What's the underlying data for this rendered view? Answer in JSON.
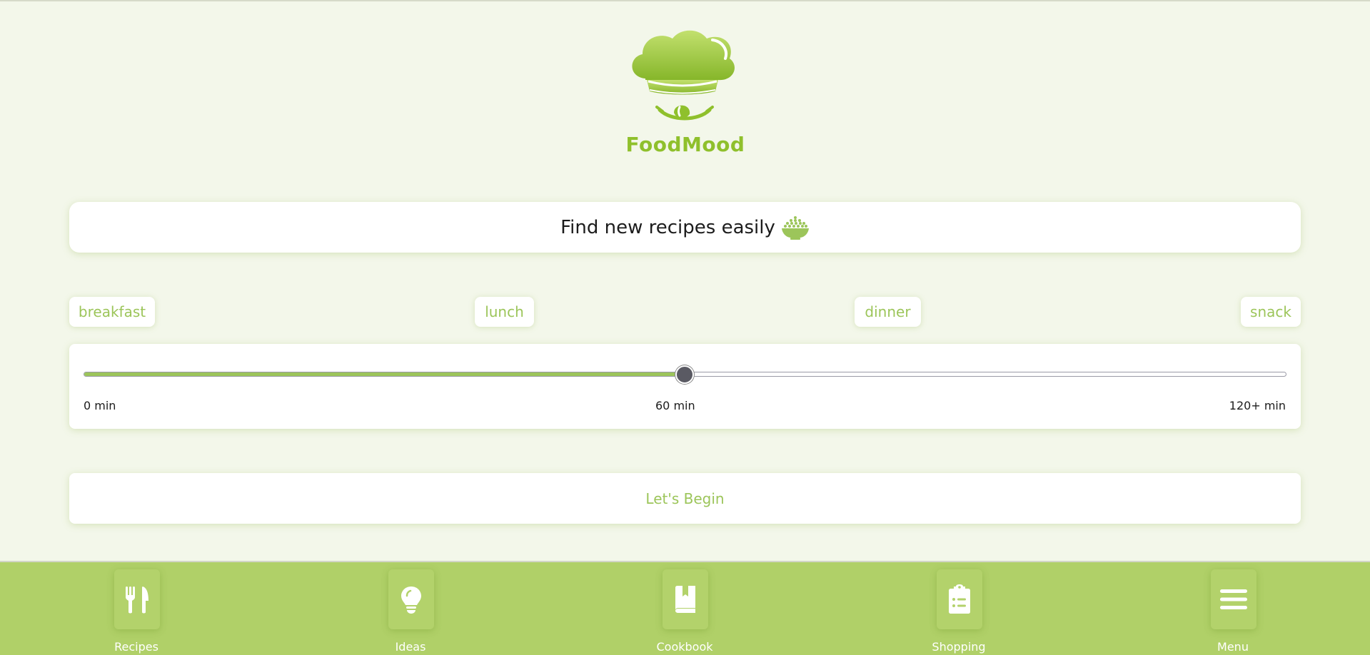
{
  "app": {
    "name": "FoodMood",
    "accent_color": "#9cc55a",
    "brand_color": "#8fc02c",
    "nav_color": "#b0d068",
    "background_color": "#f3f7ea"
  },
  "logo": {
    "icon": "chef-hat-smile-icon"
  },
  "headline": {
    "text": "Find new recipes easily",
    "icon": "bowl-icon"
  },
  "meal_filters": [
    {
      "label": "breakfast"
    },
    {
      "label": "lunch"
    },
    {
      "label": "dinner"
    },
    {
      "label": "snack"
    }
  ],
  "time_slider": {
    "min": 0,
    "max": 120,
    "value": 60,
    "labels": {
      "start": "0 min",
      "middle": "60 min",
      "end": "120+ min"
    }
  },
  "begin_button": {
    "label": "Let's Begin"
  },
  "bottom_nav": {
    "items": [
      {
        "label": "Recipes",
        "icon": "utensils-icon"
      },
      {
        "label": "Ideas",
        "icon": "lightbulb-icon"
      },
      {
        "label": "Cookbook",
        "icon": "book-icon"
      },
      {
        "label": "Shopping",
        "icon": "clipboard-list-icon"
      },
      {
        "label": "Menu",
        "icon": "hamburger-menu-icon"
      }
    ]
  }
}
